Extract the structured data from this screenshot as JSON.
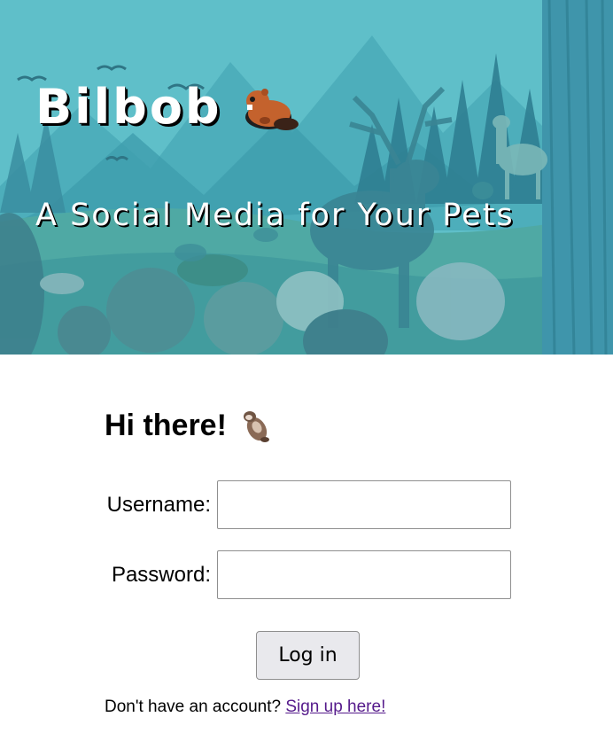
{
  "hero": {
    "title": "Bilbob",
    "title_emoji": "beaver-icon",
    "subtitle": "A Social Media for Your Pets"
  },
  "login": {
    "greeting": "Hi there!",
    "greeting_emoji": "otter-icon",
    "username_label": "Username:",
    "username_value": "",
    "password_label": "Password:",
    "password_value": "",
    "submit_label": "Log in",
    "signup_prompt": "Don't have an account?",
    "signup_link": "Sign up here!"
  },
  "colors": {
    "hero_teal": "#58b6c2",
    "link_visited": "#551a8b",
    "button_bg": "#e9e9ed"
  }
}
